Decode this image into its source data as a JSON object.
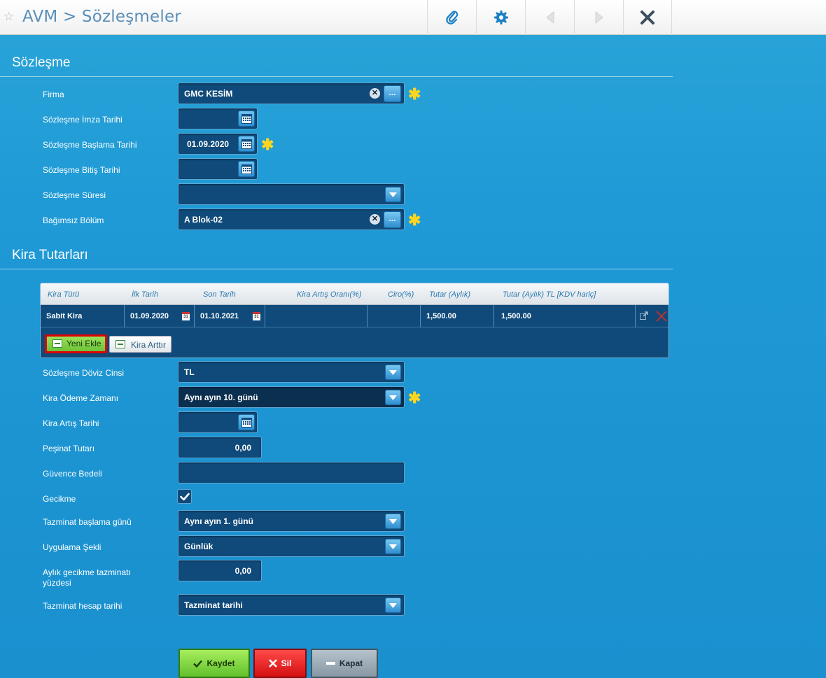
{
  "header": {
    "title": "AVM > Sözleşmeler",
    "buttons": [
      "attachment-icon",
      "settings-icon",
      "prev-icon",
      "next-icon",
      "close-icon"
    ]
  },
  "sections": {
    "contract": "Sözleşme",
    "rent": "Kira Tutarları"
  },
  "form": {
    "firma": {
      "label": "Firma",
      "value": "GMC KESİM",
      "more": "..."
    },
    "imza_tarihi": {
      "label": "Sözleşme İmza Tarihi",
      "value": ""
    },
    "baslama_tarihi": {
      "label": "Sözleşme Başlama Tarihi",
      "value": "01.09.2020"
    },
    "bitis_tarihi": {
      "label": "Sözleşme Bitiş Tarihi",
      "value": ""
    },
    "sure": {
      "label": "Sözleşme Süresi",
      "value": ""
    },
    "bolum": {
      "label": "Bağımsız Bölüm",
      "value": "A Blok-02",
      "more": "..."
    },
    "doviz": {
      "label": "Sözleşme Döviz Cinsi",
      "value": "TL"
    },
    "odeme_zamani": {
      "label": "Kira Ödeme Zamanı",
      "value": "Aynı ayın 10. günü"
    },
    "artis_tarihi": {
      "label": "Kira Artış Tarihi",
      "value": ""
    },
    "pesinat": {
      "label": "Peşinat Tutarı",
      "value": "0,00"
    },
    "guvence": {
      "label": "Güvence Bedeli",
      "value": ""
    },
    "gecikme": {
      "label": "Gecikme",
      "checked": true
    },
    "tazminat_baslama": {
      "label": "Tazminat başlama günü",
      "value": "Aynı ayın 1. günü"
    },
    "uygulama": {
      "label": "Uygulama Şekli",
      "value": "Günlük"
    },
    "aylik_gecikme": {
      "label_line1": "Aylık gecikme tazminatı",
      "label_line2": "yüzdesi",
      "value": "0,00"
    },
    "hesap_tarihi": {
      "label": "Tazminat hesap tarihi",
      "value": "Tazminat tarihi"
    }
  },
  "grid": {
    "headers": [
      "Kira Türü",
      "İlk Tarih",
      "Son Tarih",
      "Kira Artış Oranı(%)",
      "Ciro(%)",
      "Tutar (Aylık)",
      "Tutar (Aylık) TL [KDV hariç]"
    ],
    "row": {
      "kira_turu": "Sabit Kira",
      "ilk_tarih": "01.09.2020",
      "son_tarih": "01.10.2021",
      "artis_orani": "",
      "ciro": "",
      "tutar": "1,500.00",
      "tutar_tl": "1,500.00",
      "cal_day": "31"
    },
    "buttons": {
      "yeni_ekle": "Yeni Ekle",
      "kira_arttir": "Kira Arttır"
    }
  },
  "actions": {
    "kaydet": "Kaydet",
    "sil": "Sil",
    "kapat": "Kapat"
  },
  "colors": {
    "accent": "#1d95d2",
    "field": "#0f4a7a",
    "required": "#ffd51e",
    "save": "#6cc33a",
    "delete": "#d41010"
  }
}
